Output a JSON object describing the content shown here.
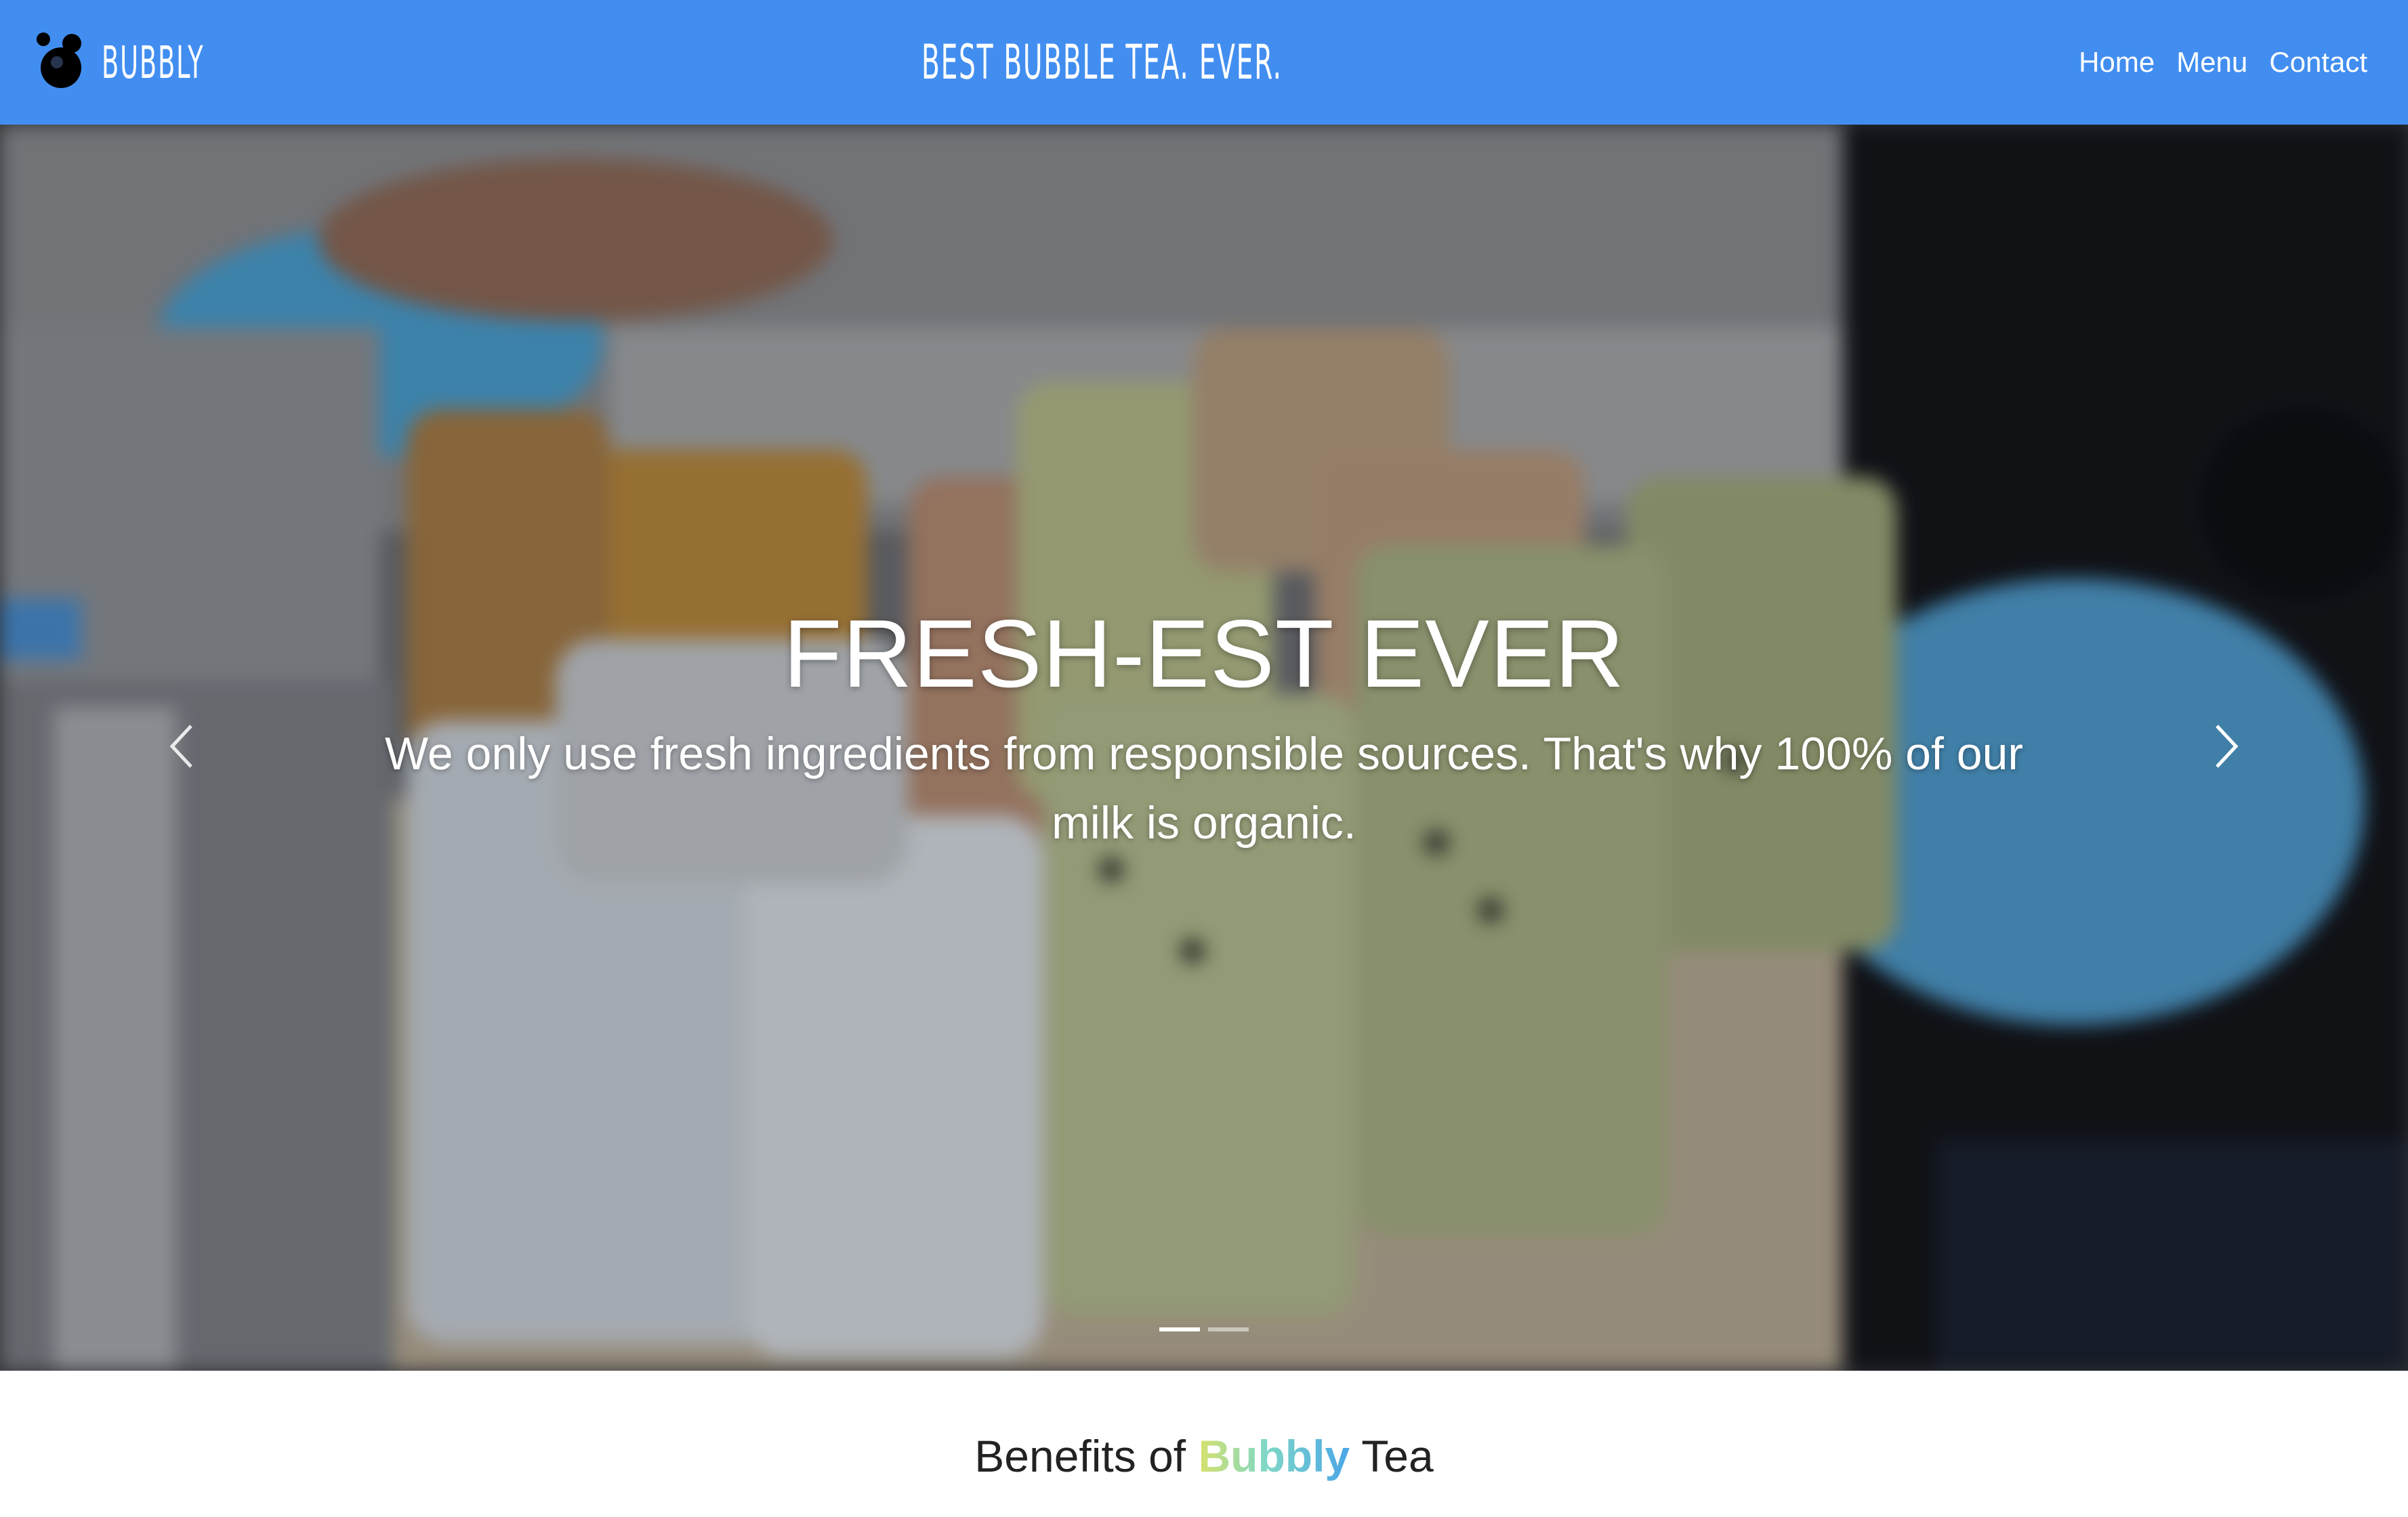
{
  "navbar": {
    "brand": "BUBBLY",
    "tagline": "BEST BUBBLE TEA. EVER.",
    "links": [
      "Home",
      "Menu",
      "Contact"
    ],
    "background_color": "#428ef0"
  },
  "carousel": {
    "slide_title": "FRESH-EST EVER",
    "slide_text": "We only use fresh ingredients from responsible sources. That's why 100% of our milk is organic.",
    "prev_icon": "chevron-left-icon",
    "next_icon": "chevron-right-icon",
    "slide_count": 2,
    "active_slide": 1
  },
  "benefits": {
    "prefix": "Benefits of",
    "highlight": "Bubbly",
    "suffix": "Tea",
    "highlight_gradient": [
      "#d7e26b",
      "#7fd7c7",
      "#4aa6e6"
    ]
  }
}
